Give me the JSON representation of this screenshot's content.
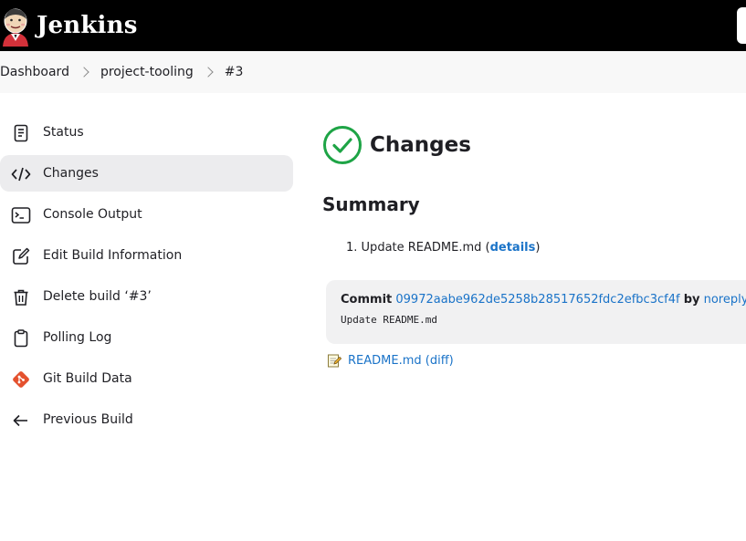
{
  "header": {
    "title": "Jenkins"
  },
  "breadcrumb": [
    "Dashboard",
    "project-tooling",
    "#3"
  ],
  "sidebar": {
    "items": [
      {
        "label": "Status",
        "icon": "status-icon"
      },
      {
        "label": "Changes",
        "icon": "code-icon"
      },
      {
        "label": "Console Output",
        "icon": "terminal-icon"
      },
      {
        "label": "Edit Build Information",
        "icon": "edit-icon"
      },
      {
        "label": "Delete build ‘#3’",
        "icon": "trash-icon"
      },
      {
        "label": "Polling Log",
        "icon": "clipboard-icon"
      },
      {
        "label": "Git Build Data",
        "icon": "git-icon"
      },
      {
        "label": "Previous Build",
        "icon": "arrow-left-icon"
      }
    ]
  },
  "main": {
    "title": "Changes",
    "summary_heading": "Summary",
    "change_item_number": "1.",
    "change_item_text": "Update README.md (",
    "change_item_link": "details",
    "change_item_close": ")",
    "commit": {
      "label": "Commit",
      "hash": "09972aabe962de5258b28517652fdc2efbc3cf4f",
      "by": "by",
      "author": "noreply",
      "message": "Update README.md"
    },
    "file": {
      "name": "README.md",
      "diff": "(diff)"
    }
  },
  "colors": {
    "header_bg": "#000000",
    "link": "#1a73c8",
    "success": "#1ea446",
    "active_bg": "#ececee"
  }
}
